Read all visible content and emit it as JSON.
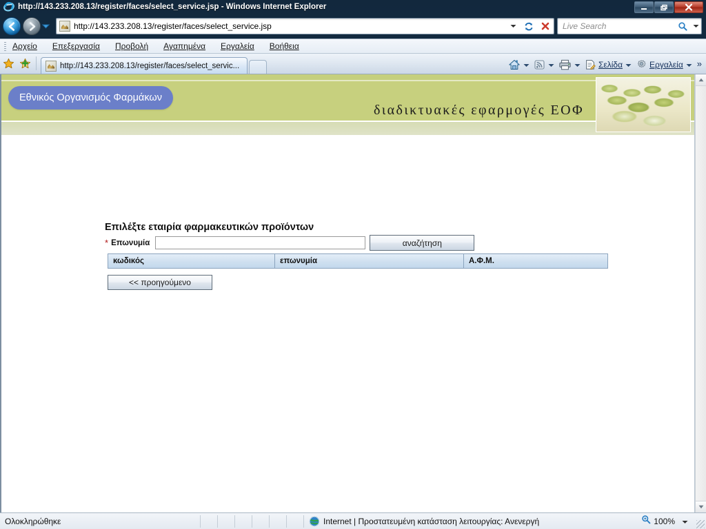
{
  "window": {
    "title": "http://143.233.208.13/register/faces/select_service.jsp - Windows Internet Explorer",
    "minimize_label": "Minimize",
    "restore_label": "Restore",
    "close_label": "Close"
  },
  "navigation": {
    "back_label": "Back",
    "forward_label": "Forward",
    "history_label": "Recent Pages",
    "address_value": "http://143.233.208.13/register/faces/select_service.jsp",
    "address_dropdown_label": "Address dropdown",
    "refresh_label": "Refresh",
    "stop_label": "Stop"
  },
  "search": {
    "placeholder": "Live Search",
    "value": "",
    "go_label": "Search",
    "provider_dropdown_label": "Change search provider"
  },
  "menu": {
    "items": [
      {
        "label": "Αρχείο",
        "accel": "Α"
      },
      {
        "label": "Επεξεργασία",
        "accel": "ξ"
      },
      {
        "label": "Προβολή",
        "accel": "Π"
      },
      {
        "label": "Αγαπημένα",
        "accel": "γ"
      },
      {
        "label": "Εργαλεία",
        "accel": "Ε"
      },
      {
        "label": "Βοήθεια",
        "accel": "Β"
      }
    ]
  },
  "favorites_bar": {
    "favorites_center_label": "Favorites Center",
    "add_favorite_label": "Add to Favorites"
  },
  "tabs": [
    {
      "label": "http://143.233.208.13/register/faces/select_servic...",
      "active": true
    }
  ],
  "new_tab_label": "New Tab",
  "command_bar": {
    "home_label": "Home",
    "feeds_label": "Feeds",
    "print_label": "Print",
    "page_label": "Σελίδα",
    "page_accel": "Σ",
    "tools_label": "Εργαλεία",
    "tools_accel": "ρ",
    "overflow_label": "»"
  },
  "site_banner": {
    "organization": "Εθνικός Οργανισμός Φαρμάκων",
    "slogan": "διαδικτυακές εφαρμογές ΕΟΦ",
    "image_label": "pills-photo",
    "badge_color": "#6b7fc9",
    "band_color": "#c7d07e",
    "base_color": "#dfe3c8"
  },
  "page": {
    "heading": "Επιλέξτε εταιρία φαρμακευτικών προϊόντων",
    "required_mark": "*",
    "field_label": "Επωνυμία",
    "field_value": "",
    "field_placeholder": "",
    "search_button": "αναζήτηση",
    "previous_button": "<< προηγούμενο",
    "table": {
      "columns": [
        "κωδικός",
        "επωνυμία",
        "Α.Φ.Μ."
      ],
      "rows": []
    }
  },
  "status_bar": {
    "message": "Ολοκληρώθηκε",
    "zone": "Internet | Προστατευμένη κατάσταση λειτουργίας: Ανενεργή",
    "zoom": "100%",
    "zoom_dropdown_label": "Change zoom level"
  },
  "scrollbar": {
    "up_label": "Scroll up",
    "down_label": "Scroll down"
  }
}
